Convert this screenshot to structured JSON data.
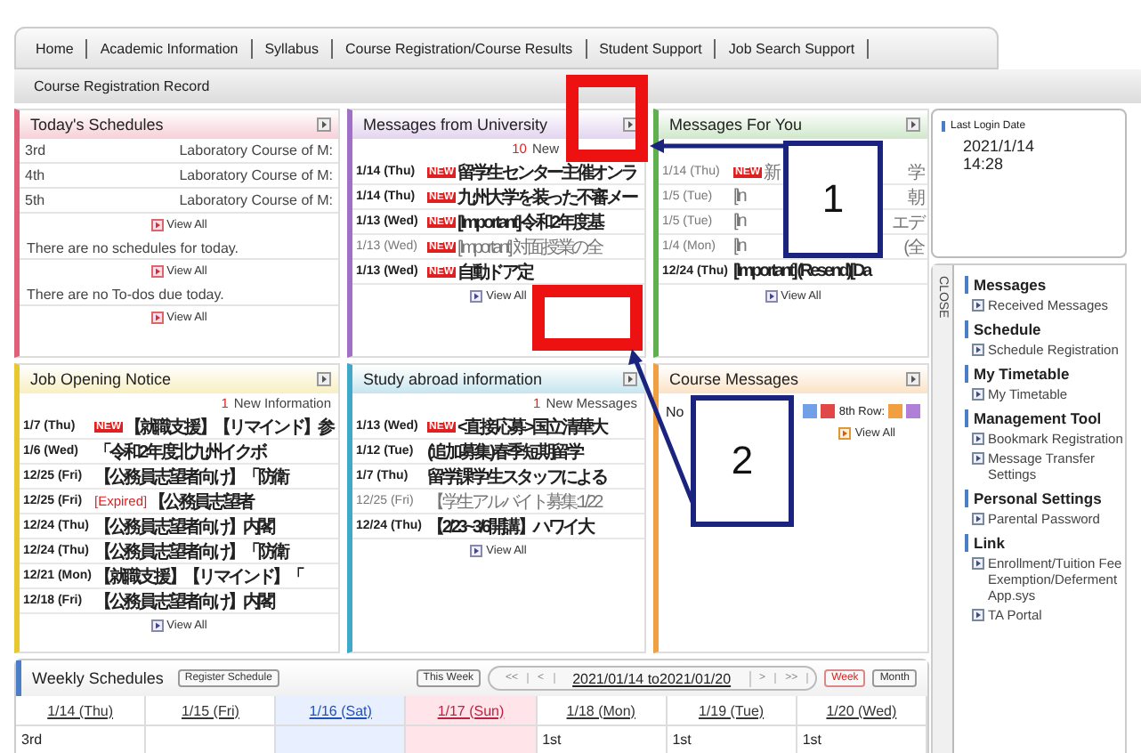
{
  "nav": [
    "Home",
    "Academic Information",
    "Syllabus",
    "Course Registration/Course Results",
    "Student Support",
    "Job Search Support"
  ],
  "subnav": [
    "Course Registration Record"
  ],
  "panels": [
    {
      "kind": "schedule",
      "title": "Today's Schedules",
      "color": "#e0607a",
      "blocks": [
        {
          "rows": [
            {
              "period": "3rd",
              "course": "Laboratory Course of M:"
            },
            {
              "period": "4th",
              "course": "Laboratory Course of M:"
            },
            {
              "period": "5th",
              "course": "Laboratory Course of M:"
            }
          ],
          "view_all": "View All"
        },
        {
          "note": "There are no schedules for today.",
          "view_all": "View All"
        },
        {
          "note": "There are no To-dos due today.",
          "view_all": "View All"
        }
      ]
    },
    {
      "kind": "messages",
      "title": "Messages from University",
      "color": "#a070c8",
      "count": "10",
      "count_label": "New",
      "items": [
        {
          "date": "1/14 (Thu)",
          "badge": "NEW",
          "subject": "留学生センター主催オンラ",
          "read": false
        },
        {
          "date": "1/14 (Thu)",
          "badge": "NEW",
          "subject": "九州大学を装った不審メー",
          "read": false
        },
        {
          "date": "1/13 (Wed)",
          "badge": "NEW",
          "subject": "[Important] 令和2年度基",
          "read": false
        },
        {
          "date": "1/13 (Wed)",
          "badge": "NEW",
          "subject": "[Important] 対面授業の全",
          "read": true
        },
        {
          "date": "1/13 (Wed)",
          "badge": "NEW",
          "subject": "自動ドア定",
          "read": false
        }
      ],
      "view_all": "View All"
    },
    {
      "kind": "messages",
      "title": "Messages For You",
      "color": "#60b050",
      "items": [
        {
          "date": "1/14 (Thu)",
          "badge": "NEW",
          "subject": "新",
          "tail": "学",
          "read": true
        },
        {
          "date": "1/5 (Tue)",
          "subject": "[In",
          "tail": "朝",
          "read": true
        },
        {
          "date": "1/5 (Tue)",
          "subject": "[In",
          "tail": "エデ",
          "read": true
        },
        {
          "date": "1/4 (Mon)",
          "subject": "[In",
          "tail": "(全",
          "read": true
        },
        {
          "date": "12/24 (Thu)",
          "subject": "[Important] (Resend)[Da",
          "read": false
        }
      ],
      "view_all": "View All"
    },
    {
      "kind": "messages",
      "title": "Job Opening Notice",
      "color": "#e8c830",
      "count": "1",
      "count_label": "New Information",
      "items": [
        {
          "date": "1/7 (Thu)",
          "badge": "NEW",
          "subject": "【就職支援】【リマインド】参",
          "read": false
        },
        {
          "date": "1/6 (Wed)",
          "subject": "「令和2年度北九州イクボ",
          "read": false
        },
        {
          "date": "12/25 (Fri)",
          "subject": "【公務員志望者向け】「防衛",
          "read": false
        },
        {
          "date": "12/25 (Fri)",
          "label": "[Expired]",
          "subject": "【公務員志望者",
          "read": false
        },
        {
          "date": "12/24 (Thu)",
          "subject": "【公務員志望者向け】内閣",
          "read": false
        },
        {
          "date": "12/24 (Thu)",
          "subject": "【公務員志望者向け】「防衛",
          "read": false
        },
        {
          "date": "12/21 (Mon)",
          "subject": "【就職支援】【リマインド】「",
          "read": false
        },
        {
          "date": "12/18 (Fri)",
          "subject": "【公務員志望者向け】内閣",
          "read": false
        }
      ],
      "view_all": "View All"
    },
    {
      "kind": "messages",
      "title": "Study abroad information",
      "color": "#40a8c8",
      "count": "1",
      "count_label": "New Messages",
      "items": [
        {
          "date": "1/13 (Wed)",
          "badge": "NEW",
          "subject": "<直接応募>国立清華大",
          "read": false
        },
        {
          "date": "1/12 (Tue)",
          "subject": "(追加募集)春季短期留学",
          "read": false
        },
        {
          "date": "1/7 (Thu)",
          "subject": "留学課学生スタッフによる",
          "read": false
        },
        {
          "date": "12/25 (Fri)",
          "subject": "【学生アルバイト募集:1/22",
          "read": true
        },
        {
          "date": "12/24 (Thu)",
          "subject": "【2/23~3/6開講】ハワイ大",
          "read": false
        }
      ],
      "view_all": "View All"
    },
    {
      "kind": "course",
      "title": "Course Messages",
      "color": "#f0a040",
      "note": "No",
      "row_label": "8th Row:",
      "view_all": "View All"
    }
  ],
  "login": {
    "label": "Last Login Date",
    "date": "2021/1/14",
    "time": "14:28"
  },
  "close_tab": "CLOSE",
  "menu": [
    {
      "title": "Messages",
      "items": [
        "Received Messages"
      ]
    },
    {
      "title": "Schedule",
      "items": [
        "Schedule Registration"
      ]
    },
    {
      "title": "My Timetable",
      "items": [
        "My Timetable"
      ]
    },
    {
      "title": "Management Tool",
      "items": [
        "Bookmark Registration",
        "Message Transfer Settings"
      ]
    },
    {
      "title": "Personal Settings",
      "items": [
        "Parental Password"
      ]
    },
    {
      "title": "Link",
      "items": [
        "Enrollment/Tuition Fee Exemption/Deferment App.sys",
        "TA Portal"
      ]
    }
  ],
  "weekly": {
    "title": "Weekly Schedules",
    "register": "Register Schedule",
    "this_week": "This Week",
    "prev": [
      "<<",
      "<"
    ],
    "range": "2021/01/14 to2021/01/20",
    "next": [
      ">",
      ">>"
    ],
    "views": [
      {
        "label": "Week",
        "selected": true
      },
      {
        "label": "Month",
        "selected": false
      }
    ],
    "days": [
      {
        "label": "1/14 (Thu)",
        "kind": "weekday"
      },
      {
        "label": "1/15 (Fri)",
        "kind": "weekday"
      },
      {
        "label": "1/16 (Sat)",
        "kind": "saturday"
      },
      {
        "label": "1/17 (Sun)",
        "kind": "sunday"
      },
      {
        "label": "1/18 (Mon)",
        "kind": "weekday"
      },
      {
        "label": "1/19 (Tue)",
        "kind": "weekday"
      },
      {
        "label": "1/20 (Wed)",
        "kind": "weekday"
      }
    ],
    "cells": [
      "3rd",
      null,
      null,
      null,
      "1st",
      "1st",
      "1st"
    ]
  },
  "callouts": [
    "1",
    "2"
  ]
}
